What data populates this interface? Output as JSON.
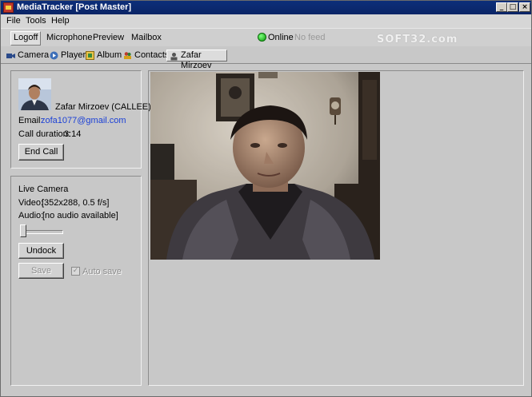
{
  "window": {
    "title": "MediaTracker [Post Master]"
  },
  "menu": [
    "File",
    "Tools",
    "Help"
  ],
  "toolbar": {
    "items": [
      "Logoff",
      "Microphone",
      "Preview",
      "Mailbox"
    ],
    "status": "Online",
    "feed": "No feed"
  },
  "watermark": "SOFT32.com",
  "tabs": [
    "Camera",
    "Player",
    "Album",
    "Contacts",
    "Zafar Mirzoev"
  ],
  "contact": {
    "name": "Zafar Mirzoev (CALLEE)",
    "email_label": "Email:",
    "email": "zofa1077@gmail.com",
    "duration_label": "Call duration:",
    "duration": "3:14",
    "end_call": "End Call"
  },
  "camera": {
    "heading": "Live Camera",
    "video_label": "Video:",
    "video_info": "[352x288, 0.5 f/s]",
    "audio_label": "Audio:",
    "audio_info": "[no audio available]",
    "volume": 0,
    "undock": "Undock",
    "save": "Save",
    "autosave": "Auto save",
    "autosave_checked": true
  }
}
